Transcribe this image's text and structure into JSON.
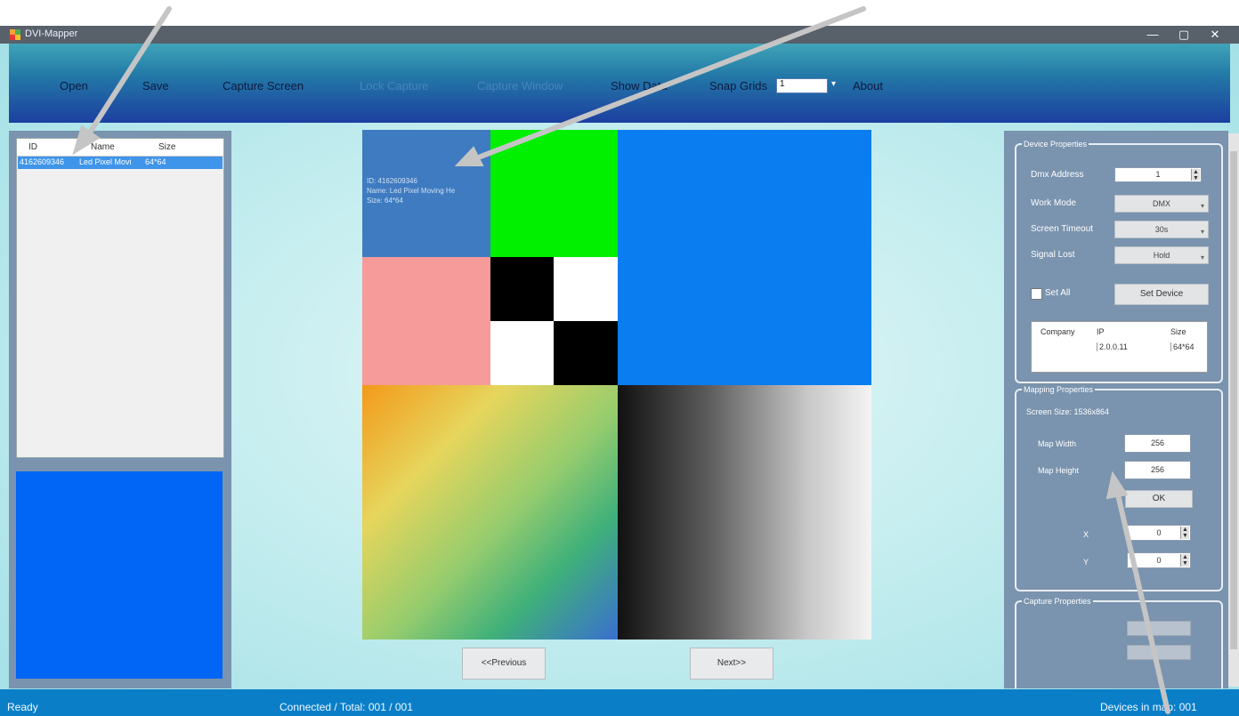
{
  "window": {
    "title": "DVI-Mapper",
    "min": "—",
    "max": "▢",
    "close": "✕"
  },
  "menu": {
    "open": "Open",
    "save": "Save",
    "capture_screen": "Capture Screen",
    "lock_capture": "Lock Capture",
    "capture_window": "Capture Window",
    "show_data": "Show Data",
    "snap_grids": "Snap Grids",
    "snap_value": "1",
    "about": "About"
  },
  "device_list": {
    "columns": [
      "ID",
      "Name",
      "Size"
    ],
    "rows": [
      {
        "id": "4162609346",
        "name": "Led Pixel Movi",
        "size": "64*64"
      }
    ]
  },
  "canvas_info": {
    "id": "ID: 4162609346",
    "name": "Name: Led Pixel Moving He",
    "size": "Size: 64*64"
  },
  "nav": {
    "previous": "<<Previous",
    "next": "Next>>"
  },
  "device_properties": {
    "legend": "Device Properties",
    "dmx_address_label": "Dmx Address",
    "dmx_address": "1",
    "work_mode_label": "Work Mode",
    "work_mode": "DMX",
    "screen_timeout_label": "Screen Timeout",
    "screen_timeout": "30s",
    "signal_lost_label": "Signal Lost",
    "signal_lost": "Hold",
    "set_all": "Set All",
    "set_device": "Set Device",
    "table_columns": [
      "Company",
      "IP",
      "Size"
    ],
    "table_row": {
      "company": "",
      "ip": "2.0.0.11",
      "size": "64*64"
    }
  },
  "mapping_properties": {
    "legend": "Mapping Properties",
    "screen_size": "Screen Size: 1536x864",
    "map_width_label": "Map Width",
    "map_width": "256",
    "map_height_label": "Map Height",
    "map_height": "256",
    "ok": "OK",
    "x_label": "X",
    "x": "0",
    "y_label": "Y",
    "y": "0"
  },
  "capture_properties": {
    "legend": "Capture Properties"
  },
  "status": {
    "ready": "Ready",
    "connected": "Connected / Total: 001 / 001",
    "devices": "Devices in map: 001"
  },
  "colors": {
    "menubar_top": "#3fa4b8",
    "menubar_bottom": "#1c3fa0",
    "panel": "#7a93ae",
    "status": "#0a7fc8",
    "selection": "#3f95ea"
  }
}
